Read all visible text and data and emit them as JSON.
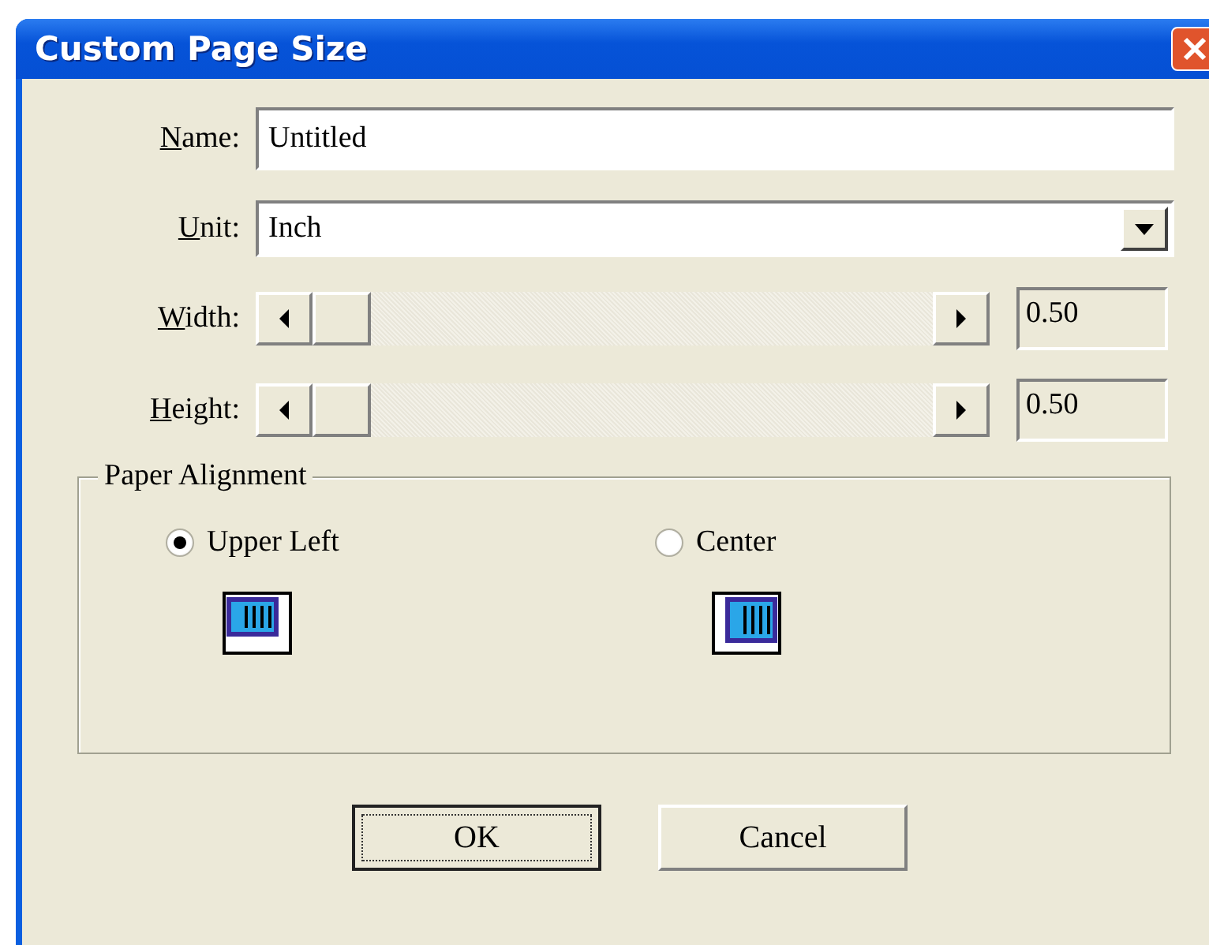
{
  "window": {
    "title": "Custom Page Size"
  },
  "fields": [
    {
      "label": "Name:",
      "value": "Untitled",
      "kind": "text"
    },
    {
      "label": "Unit:",
      "value": "Inch",
      "kind": "dropdown"
    }
  ],
  "sliders": [
    {
      "label": "Width:",
      "level": 0,
      "reading": "0.50"
    },
    {
      "label": "Height:",
      "level": 0,
      "reading": "0.50"
    }
  ],
  "alignment": {
    "title": "Paper Alignment",
    "options": [
      {
        "label": "Upper Left",
        "selected": true,
        "kind": "corner"
      },
      {
        "label": "Center",
        "selected": false,
        "kind": "center"
      }
    ]
  },
  "buttons": [
    {
      "label": "OK",
      "default": true
    },
    {
      "label": "Cancel",
      "default": false
    }
  ]
}
